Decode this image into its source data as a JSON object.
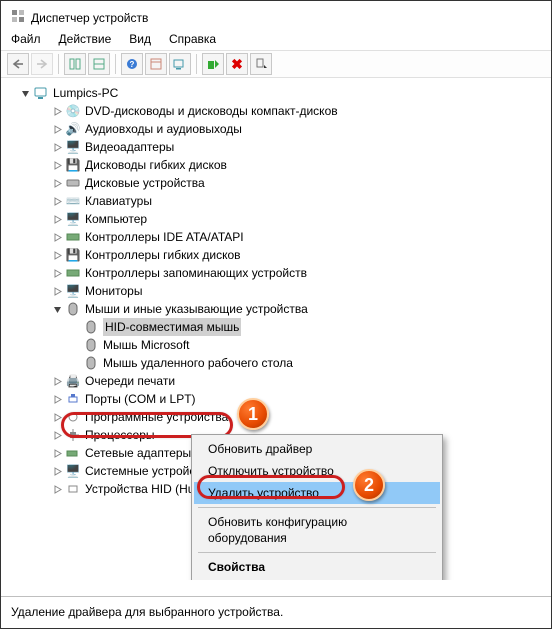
{
  "window": {
    "title": "Диспетчер устройств"
  },
  "menubar": {
    "file": "Файл",
    "action": "Действие",
    "view": "Вид",
    "help": "Справка"
  },
  "tree": {
    "root": "Lumpics-PC",
    "cat": {
      "dvd": "DVD-дисководы и дисководы компакт-дисков",
      "audio": "Аудиовходы и аудиовыходы",
      "video": "Видеоадаптеры",
      "floppy": "Дисководы гибких дисков",
      "disk": "Дисковые устройства",
      "keyboard": "Клавиатуры",
      "computer": "Компьютер",
      "ide": "Контроллеры IDE ATA/ATAPI",
      "floppyctrl": "Контроллеры гибких дисков",
      "storage": "Контроллеры запоминающих устройств",
      "monitor": "Мониторы",
      "mouse": "Мыши и иные указывающие устройства",
      "printq": "Очереди печати",
      "ports": "Порты (COM и LPT)",
      "soft": "Программные устройства",
      "cpu": "Процессоры",
      "net": "Сетевые адаптеры",
      "system": "Системные устройства",
      "hid": "Устройства HID (Human Interface Devices)"
    },
    "mice": {
      "hid": "HID-совместимая мышь",
      "micro": "Мышь Microsoft",
      "del": "Мышь удаленного рабочего стола"
    }
  },
  "ctx": {
    "update": "Обновить драйвер",
    "disable": "Отключить устройство",
    "uninstall": "Удалить устройство",
    "scan": "Обновить конфигурацию оборудования",
    "props": "Свойства"
  },
  "status": "Удаление драйвера для выбранного устройства.",
  "badges": {
    "one": "1",
    "two": "2"
  },
  "icons": {
    "back": "back-icon",
    "fwd": "forward-icon",
    "grid1": "view-icon-1",
    "grid2": "view-icon-2",
    "help": "help-icon",
    "calendar": "properties-icon",
    "monitor": "scan-icon",
    "update": "update-driver-icon",
    "uninstall": "uninstall-icon",
    "more": "more-icon"
  }
}
